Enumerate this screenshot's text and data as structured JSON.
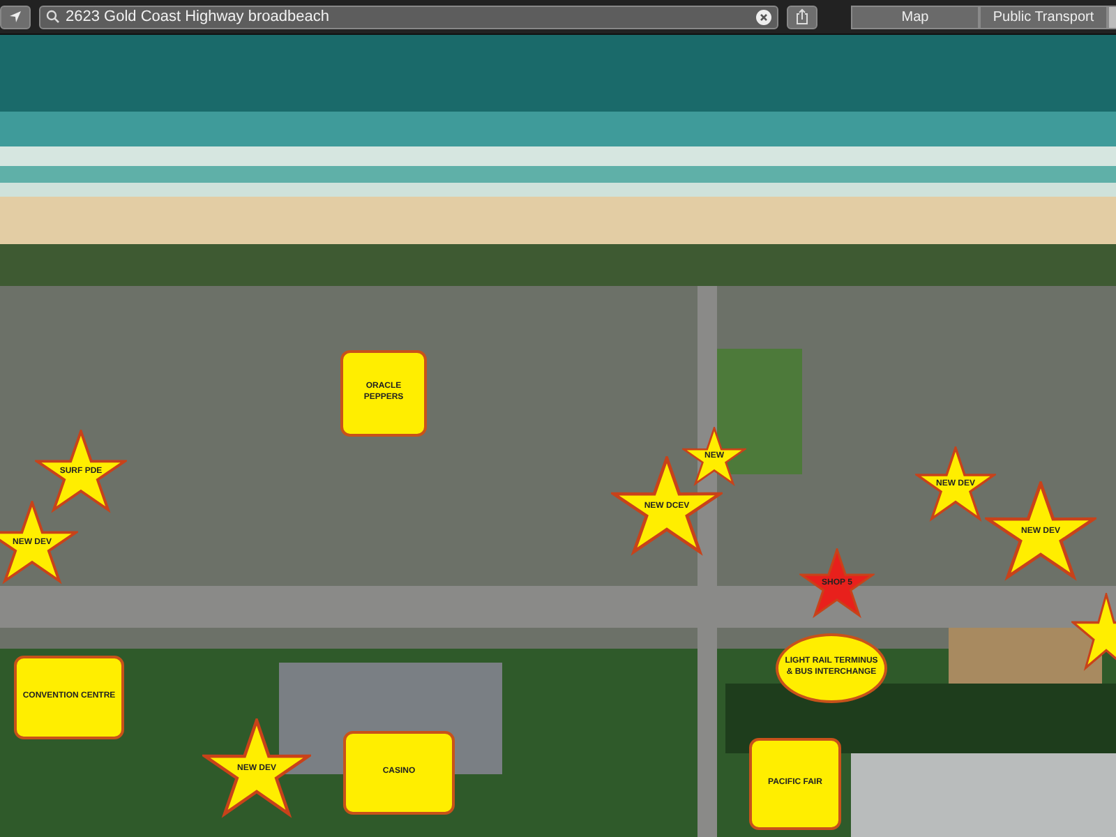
{
  "toolbar": {
    "search": {
      "value": "2623 Gold Coast Highway broadbeach"
    },
    "tabs": [
      {
        "label": "Map",
        "selected": false
      },
      {
        "label": "Public Transport",
        "selected": false
      }
    ]
  },
  "markers": [
    {
      "kind": "box",
      "label": "ORACLE PEPPERS",
      "color": "#ffee00"
    },
    {
      "kind": "star",
      "label": "SURF PDE",
      "color": "#ffee00"
    },
    {
      "kind": "star",
      "label": "NEW DEV",
      "color": "#ffee00"
    },
    {
      "kind": "star",
      "label": "NEW DCEV",
      "color": "#ffee00"
    },
    {
      "kind": "star",
      "label": "NEW",
      "color": "#ffee00"
    },
    {
      "kind": "star",
      "label": "NEW DEV",
      "color": "#ffee00"
    },
    {
      "kind": "star",
      "label": "NEW DEV",
      "color": "#ffee00"
    },
    {
      "kind": "star",
      "label": "SHOP 5",
      "color": "#e8201c"
    },
    {
      "kind": "star",
      "color": "#ffee00"
    },
    {
      "kind": "ellipse",
      "label": "LIGHT RAIL TERMINUS & BUS INTERCHANGE",
      "color": "#ffee00"
    },
    {
      "kind": "box",
      "label": "CONVENTION CENTRE",
      "color": "#ffee00"
    },
    {
      "kind": "star",
      "label": "NEW DEV",
      "color": "#ffee00"
    },
    {
      "kind": "box",
      "label": "CASINO",
      "color": "#ffee00"
    },
    {
      "kind": "box",
      "label": "PACIFIC FAIR",
      "color": "#ffee00"
    }
  ]
}
